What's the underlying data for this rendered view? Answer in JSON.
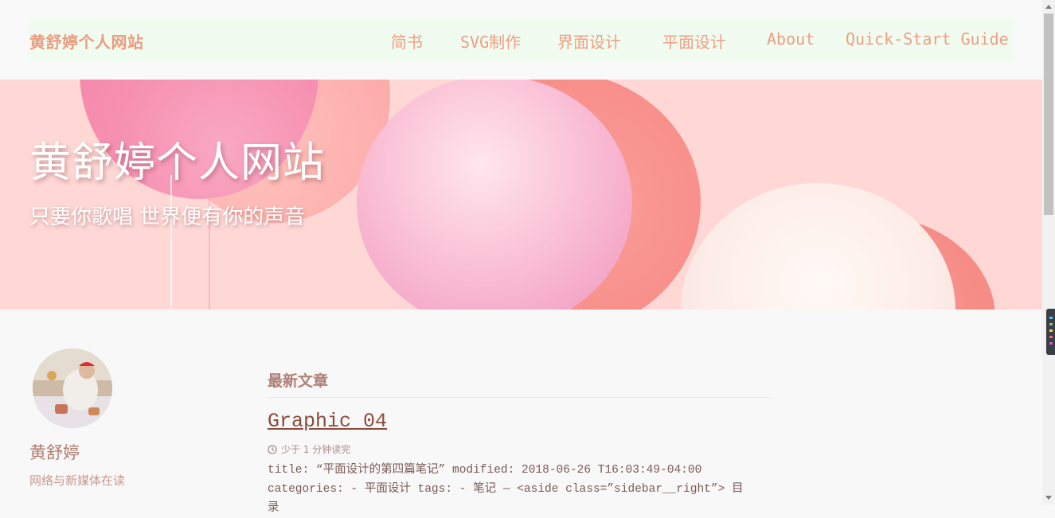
{
  "site": {
    "title": "黄舒婷个人网站"
  },
  "nav": {
    "items": [
      {
        "label": "简书"
      },
      {
        "label": "SVG制作"
      },
      {
        "label": "界面设计"
      },
      {
        "label": "平面设计"
      },
      {
        "label": "About"
      },
      {
        "label": "Quick-Start Guide"
      }
    ]
  },
  "hero": {
    "title": "黄舒婷个人网站",
    "subtitle": "只要你歌唱 世界便有你的声音"
  },
  "author": {
    "name": "黄舒婷",
    "bio": "网络与新媒体在读"
  },
  "main": {
    "section_title": "最新文章",
    "posts": [
      {
        "title": "Graphic 04",
        "read_time": "少于 1 分钟读完",
        "excerpt_line1": "title: “平面设计的第四篇笔记” modified: 2018-06-26 T16:03:49-04:00",
        "excerpt_line2": "categories: - 平面设计 tags: - 笔记 — <aside class=”sidebar__right”> 目",
        "excerpt_line3": "录"
      }
    ]
  },
  "colors": {
    "nav_text": "#ee9f85",
    "site_title": "#ea9c80",
    "nav_bg": "#f0fcef",
    "hero_bg": "#ffd8d6",
    "link": "#8a4a3c"
  },
  "icons": {
    "read_time": "clock-icon"
  }
}
